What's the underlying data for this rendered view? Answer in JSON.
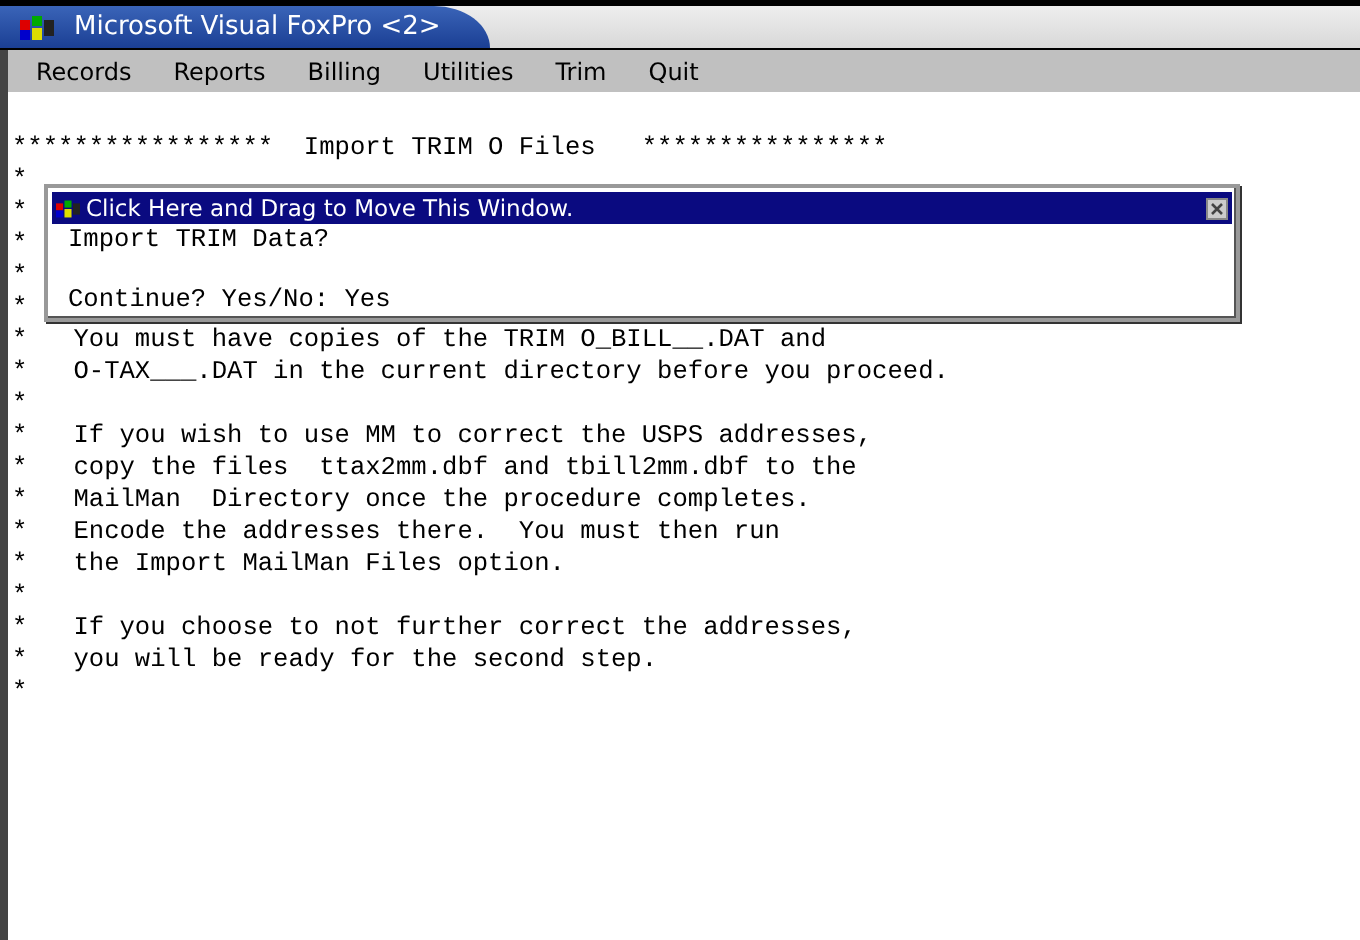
{
  "window": {
    "title": "Microsoft Visual FoxPro <2>"
  },
  "menu": [
    {
      "label": "Records"
    },
    {
      "label": "Reports"
    },
    {
      "label": "Billing"
    },
    {
      "label": "Utilities"
    },
    {
      "label": "Trim"
    },
    {
      "label": "Quit"
    }
  ],
  "console_lines": [
    "*****************  Import TRIM O Files   ****************",
    "*",
    "*",
    "*",
    "*",
    "*",
    "*   You must have copies of the TRIM O_BILL__.DAT and",
    "*   O-TAX___.DAT in the current directory before you proceed.",
    "*",
    "*   If you wish to use MM to correct the USPS addresses,",
    "*   copy the files  ttax2mm.dbf and tbill2mm.dbf to the",
    "*   MailMan  Directory once the procedure completes.",
    "*   Encode the addresses there.  You must then run",
    "*   the Import MailMan Files option.",
    "*",
    "*   If you choose to not further correct the addresses,",
    "*   you will be ready for the second step.",
    "*"
  ],
  "dialog": {
    "title": "Click Here and Drag to Move This Window.",
    "question": "Import TRIM Data?",
    "prompt": "Continue? Yes/No: Yes"
  }
}
